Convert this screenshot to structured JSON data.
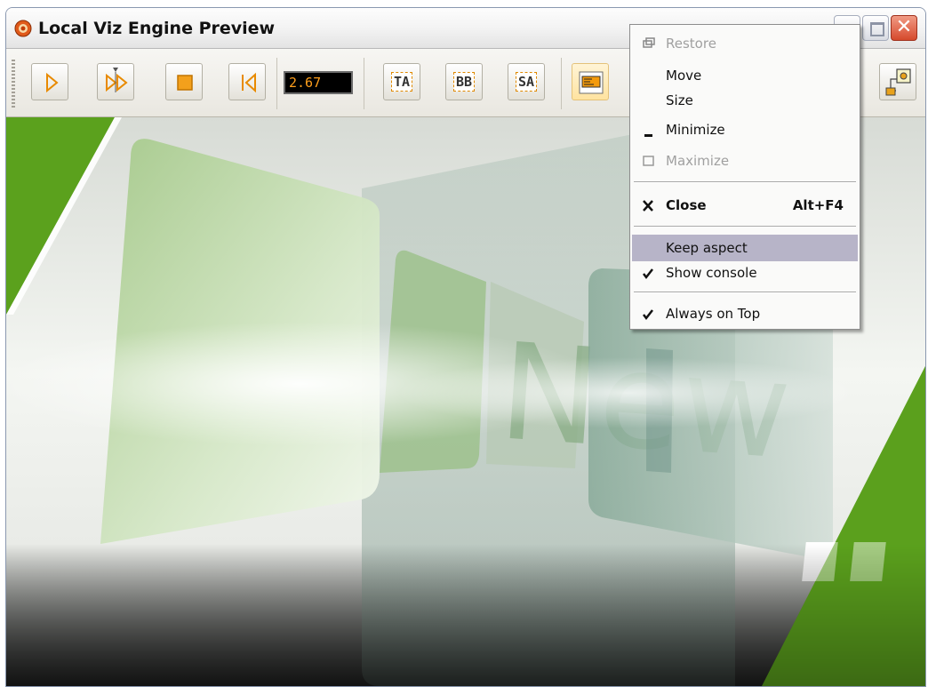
{
  "window": {
    "title": "Local Viz Engine Preview",
    "controls": {
      "close_glyph": "✕"
    }
  },
  "toolbar": {
    "buttons": [
      {
        "name": "play-button",
        "icon": "play-icon"
      },
      {
        "name": "continue-button",
        "icon": "continue-icon"
      },
      {
        "name": "stop-button",
        "icon": "stop-icon"
      },
      {
        "name": "rewind-button",
        "icon": "rewind-to-start-icon"
      },
      {
        "name": "ta-button",
        "label": "TA"
      },
      {
        "name": "bb-button",
        "label": "BB"
      },
      {
        "name": "sa-button",
        "label": "SA"
      },
      {
        "name": "layout-button",
        "icon": "layout-icon"
      },
      {
        "name": "connection-button",
        "icon": "connection-icon"
      }
    ],
    "timecode": "2.67",
    "accent_color": "#ff9f1c"
  },
  "system_menu": {
    "items": [
      {
        "label": "Restore",
        "icon": "restore-icon",
        "disabled": true
      },
      {
        "label": "Move"
      },
      {
        "label": "Size"
      },
      {
        "label": "Minimize",
        "icon": "minimize-icon"
      },
      {
        "label": "Maximize",
        "icon": "maximize-icon",
        "disabled": true
      },
      {
        "label": "Close",
        "icon": "close-x-icon",
        "shortcut": "Alt+F4",
        "bold": true
      },
      {
        "label": "Keep aspect",
        "highlighted": true
      },
      {
        "label": "Show console",
        "checked": true
      },
      {
        "label": "Always on Top",
        "checked": true
      }
    ]
  },
  "viewport": {
    "scene_text": "New",
    "colors": {
      "green": "#5ba11d",
      "light_green": "#bcd8a0",
      "teal": "#7fa8a0"
    }
  }
}
